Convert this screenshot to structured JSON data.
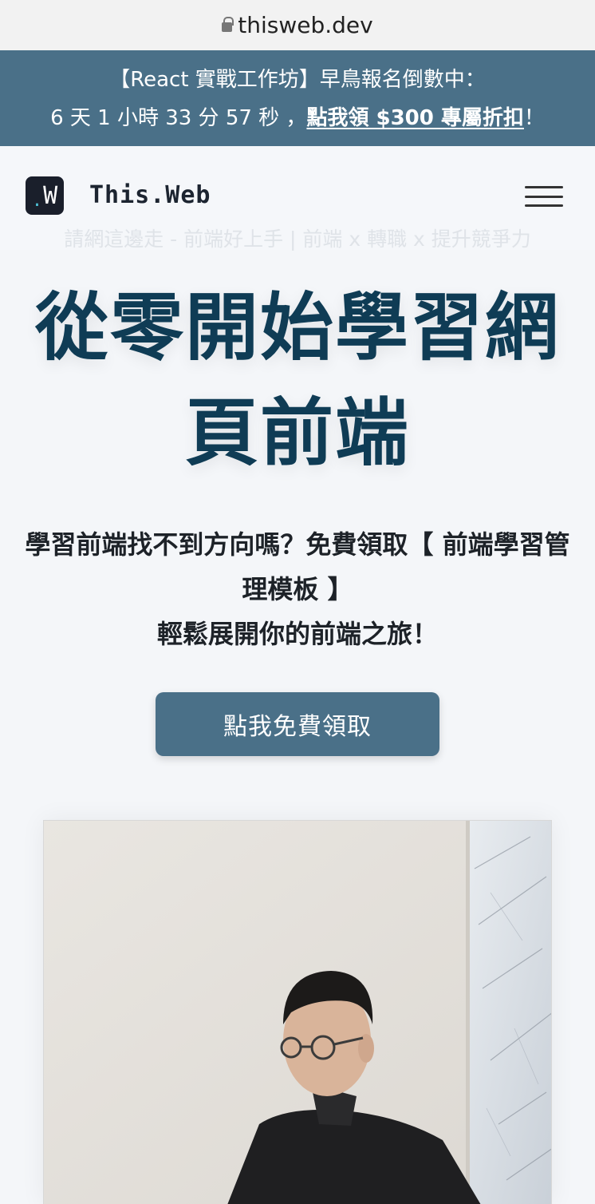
{
  "browser": {
    "url": "thisweb.dev"
  },
  "promo": {
    "line1": "【React 實戰工作坊】早鳥報名倒數中：",
    "countdown": "6 天 1 小時 33 分 57 秒 ，",
    "link": "點我領 $300 專屬折扣",
    "suffix": "！"
  },
  "header": {
    "logo_text": "W",
    "brand": "This.Web",
    "tagline": "請網這邊走 - 前端好上手 | 前端 x 轉職 x 提升競爭力"
  },
  "hero": {
    "title": "從零開始學習網頁前端",
    "subtitle_line1": "學習前端找不到方向嗎？免費領取【 前端學習管理模板 】",
    "subtitle_line2": "輕鬆展開你的前端之旅！",
    "cta_label": "點我免費領取"
  },
  "icons": {
    "lock": "lock-icon",
    "menu": "hamburger-menu-icon"
  },
  "colors": {
    "banner": "#4a7088",
    "title": "#0f3c55",
    "background": "#f4f6f9"
  }
}
